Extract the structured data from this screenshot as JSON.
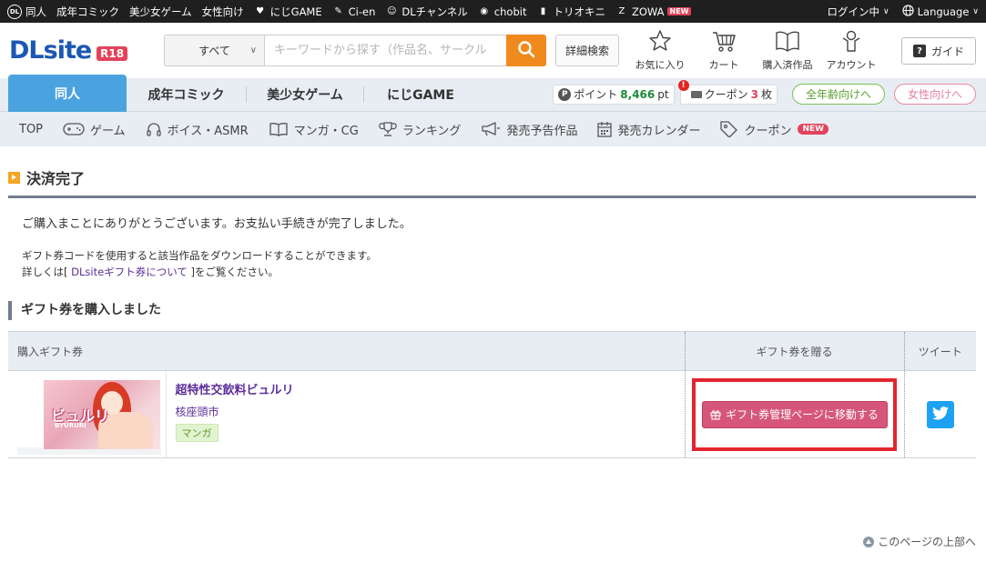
{
  "topbar": {
    "left_items": [
      {
        "icon": "dl-icon",
        "label": "同人"
      },
      {
        "icon": "",
        "label": "成年コミック"
      },
      {
        "icon": "",
        "label": "美少女ゲーム"
      },
      {
        "icon": "",
        "label": "女性向け"
      },
      {
        "icon": "heart-icon",
        "label": "にじGAME"
      },
      {
        "icon": "ci-en-icon",
        "label": "Ci-en"
      },
      {
        "icon": "dlchannel-icon",
        "label": "DLチャンネル"
      },
      {
        "icon": "chobit-icon",
        "label": "chobit"
      },
      {
        "icon": "book-icon",
        "label": "トリオキニ"
      },
      {
        "icon": "zowa-icon",
        "label": "ZOWA"
      }
    ],
    "zowa_badge": "NEW",
    "login_label": "ログイン中",
    "language_label": "Language"
  },
  "header": {
    "logo_text": "DLsite",
    "logo_badge": "R18",
    "search_category": "すべて",
    "search_placeholder": "キーワードから探す（作品名、サークル",
    "detail_search": "詳細検索",
    "icons": [
      {
        "icon": "star-icon",
        "label": "お気に入り"
      },
      {
        "icon": "cart-icon",
        "label": "カート"
      },
      {
        "icon": "book-open-icon",
        "label": "購入済作品"
      },
      {
        "icon": "account-icon",
        "label": "アカウント"
      }
    ],
    "guide": "ガイド"
  },
  "floor_tabs": [
    "同人",
    "成年コミック",
    "美少女ゲーム",
    "にじGAME"
  ],
  "points": {
    "label": "ポイント",
    "value": "8,466",
    "unit": "pt"
  },
  "coupon": {
    "label": "クーポン",
    "count": "3",
    "unit": "枚",
    "alert": "!"
  },
  "pills": {
    "all_ages": "全年齢向けへ",
    "female": "女性向けへ"
  },
  "subnav": {
    "items": [
      {
        "icon": "",
        "label": "TOP"
      },
      {
        "icon": "gamepad-icon",
        "label": "ゲーム"
      },
      {
        "icon": "headphones-icon",
        "label": "ボイス・ASMR"
      },
      {
        "icon": "book-icon",
        "label": "マンガ・CG"
      },
      {
        "icon": "trophy-icon",
        "label": "ランキング"
      },
      {
        "icon": "megaphone-icon",
        "label": "発売予告作品"
      },
      {
        "icon": "calendar-icon",
        "label": "発売カレンダー"
      },
      {
        "icon": "tag-icon",
        "label": "クーポン"
      }
    ],
    "coupon_badge": "NEW"
  },
  "main": {
    "page_title": "決済完了",
    "message": "ご購入まことにありがとうございます。お支払い手続きが完了しました。",
    "info_line1": "ギフト券コードを使用すると該当作品をダウンロードすることができます。",
    "info_prefix": "詳しくは[ ",
    "info_link": "DLsiteギフト券について",
    "info_suffix": " ]をご覧ください。",
    "section_title": "ギフト券を購入しました",
    "table": {
      "headers": [
        "購入ギフト券",
        "ギフト券を贈る",
        "ツイート"
      ],
      "row": {
        "thumb_title": "ビュルリ",
        "thumb_sub": "BYURURI",
        "title": "超特性交飲料ビュルリ",
        "circle": "核座頭市",
        "genre": "マンガ",
        "gift_button": "ギフト券管理ページに移動する"
      }
    }
  },
  "page_top": "このページの上部へ"
}
